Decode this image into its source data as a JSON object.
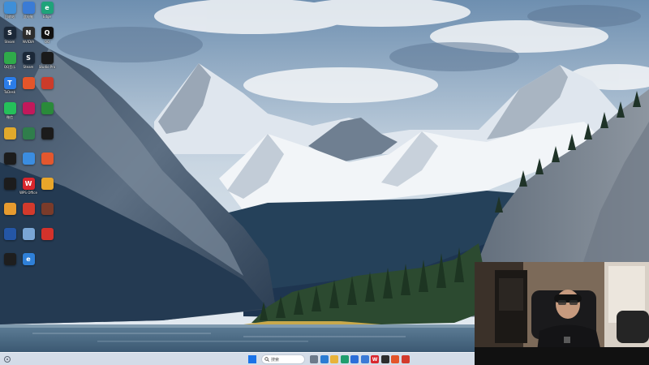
{
  "taskbar": {
    "search_placeholder": "搜索"
  },
  "desktop": {
    "icons": [
      {
        "label": "回收站",
        "glyph": "",
        "color": "#3f8fd8",
        "icon": "recycle-bin-icon"
      },
      {
        "label": "此电脑",
        "glyph": "",
        "color": "#3a7bd5",
        "icon": "computer-icon"
      },
      {
        "label": "Edge",
        "glyph": "e",
        "color": "#1fa37a",
        "icon": "edge-browser-icon"
      },
      {
        "label": "Steam",
        "glyph": "S",
        "color": "#1b2838",
        "icon": "steam-icon"
      },
      {
        "label": "NVIDIA",
        "glyph": "N",
        "color": "#2d2d2d",
        "icon": "nvidia-icon"
      },
      {
        "label": "QQ",
        "glyph": "Q",
        "color": "#111111",
        "icon": "qq-icon"
      },
      {
        "label": "QQ音乐",
        "glyph": "",
        "color": "#2faa4a",
        "icon": "qq-music-icon"
      },
      {
        "label": "Steam",
        "glyph": "S",
        "color": "#1b2838",
        "icon": "steam-icon"
      },
      {
        "label": "Studio Pro",
        "glyph": "",
        "color": "#1a1a1a",
        "icon": "studio-icon"
      },
      {
        "label": "ToDesk",
        "glyph": "T",
        "color": "#2b7de9",
        "icon": "todesk-icon"
      },
      {
        "label": "",
        "glyph": "",
        "color": "#e4552a",
        "icon": "app-icon"
      },
      {
        "label": "",
        "glyph": "",
        "color": "#cc3b2a",
        "icon": "app-icon"
      },
      {
        "label": "微信",
        "glyph": "",
        "color": "#25c05a",
        "icon": "wechat-icon"
      },
      {
        "label": "",
        "glyph": "",
        "color": "#c2195b",
        "icon": "app-icon"
      },
      {
        "label": "",
        "glyph": "",
        "color": "#2a8a3a",
        "icon": "app-icon"
      },
      {
        "label": "",
        "glyph": "",
        "color": "#e0a92c",
        "icon": "folder-icon"
      },
      {
        "label": "",
        "glyph": "",
        "color": "#2f7d4b",
        "icon": "app-icon"
      },
      {
        "label": "",
        "glyph": "",
        "color": "#1b1b1b",
        "icon": "app-icon"
      },
      {
        "label": "",
        "glyph": "",
        "color": "#1c1c1c",
        "icon": "app-icon"
      },
      {
        "label": "",
        "glyph": "",
        "color": "#3b8de0",
        "icon": "app-icon"
      },
      {
        "label": "",
        "glyph": "",
        "color": "#e3572e",
        "icon": "app-icon"
      },
      {
        "label": "",
        "glyph": "",
        "color": "#1c1c1c",
        "icon": "app-icon"
      },
      {
        "label": "WPS Office",
        "glyph": "W",
        "color": "#d9262d",
        "icon": "wps-icon"
      },
      {
        "label": "",
        "glyph": "",
        "color": "#e9a62a",
        "icon": "app-icon"
      },
      {
        "label": "",
        "glyph": "",
        "color": "#e79b2f",
        "icon": "app-icon"
      },
      {
        "label": "",
        "glyph": "",
        "color": "#d33a2c",
        "icon": "app-icon"
      },
      {
        "label": "",
        "glyph": "",
        "color": "#7a3b2a",
        "icon": "app-icon"
      },
      {
        "label": "",
        "glyph": "",
        "color": "#2456a6",
        "icon": "app-icon"
      },
      {
        "label": "",
        "glyph": "",
        "color": "#7aa6d6",
        "icon": "app-icon"
      },
      {
        "label": "",
        "glyph": "",
        "color": "#d4322b",
        "icon": "app-icon"
      },
      {
        "label": "",
        "glyph": "",
        "color": "#1e1e1e",
        "icon": "app-icon"
      },
      {
        "label": "",
        "glyph": "e",
        "color": "#2f80d8",
        "icon": "browser-icon"
      }
    ]
  },
  "taskbar_apps": [
    {
      "glyph": "",
      "color": "#6c7a8a",
      "icon": "task-view-icon"
    },
    {
      "glyph": "",
      "color": "#2b7cd3",
      "icon": "widgets-icon"
    },
    {
      "glyph": "",
      "color": "#e8b33a",
      "icon": "file-explorer-icon"
    },
    {
      "glyph": "",
      "color": "#1f9e6e",
      "icon": "edge-browser-icon"
    },
    {
      "glyph": "",
      "color": "#2b6ed9",
      "icon": "store-icon"
    },
    {
      "glyph": "",
      "color": "#3a7ad6",
      "icon": "app-icon"
    },
    {
      "glyph": "W",
      "color": "#d9262d",
      "icon": "wps-icon"
    },
    {
      "glyph": "",
      "color": "#2d2d2d",
      "icon": "app-icon"
    },
    {
      "glyph": "",
      "color": "#e4552a",
      "icon": "app-icon"
    },
    {
      "glyph": "",
      "color": "#d33a2c",
      "icon": "app-icon"
    }
  ]
}
